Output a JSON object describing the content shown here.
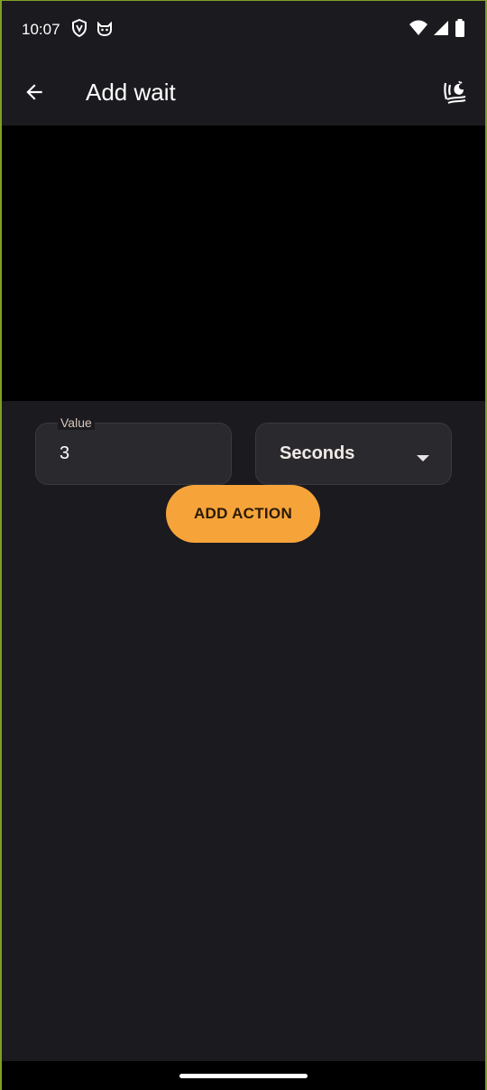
{
  "status_bar": {
    "time": "10:07",
    "left_icons": [
      "vpn-shield-icon",
      "cat-face-icon"
    ],
    "right_icons": [
      "wifi-icon",
      "cell-signal-icon",
      "battery-icon"
    ]
  },
  "app_bar": {
    "back_icon": "arrow-back-icon",
    "title": "Add wait",
    "action_icon": "gallery-icon"
  },
  "form": {
    "value_label": "Value",
    "value": "3",
    "unit": "Seconds",
    "unit_icon": "dropdown-arrow-icon",
    "add_button": "ADD ACTION"
  },
  "colors": {
    "background": "#1b1a1f",
    "accent": "#f6a43a",
    "frame_border": "#7fa021"
  }
}
